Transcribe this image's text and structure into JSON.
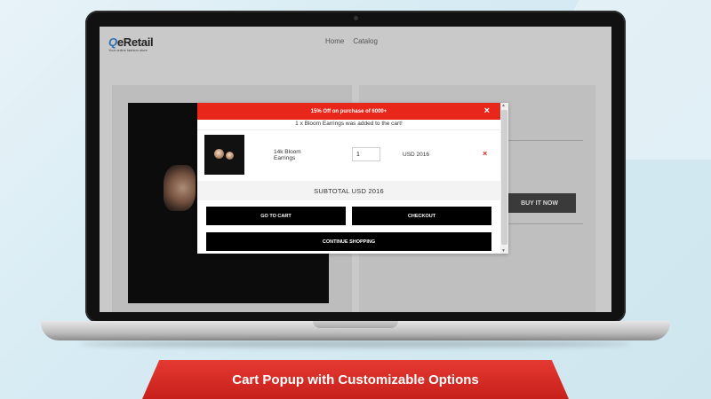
{
  "site": {
    "logo_prefix": "Q",
    "logo_name": "eRetail",
    "logo_tagline": "Your online fashion store",
    "nav": [
      "Home",
      "Catalog"
    ]
  },
  "product_page": {
    "buy_now_label": "BUY IT NOW"
  },
  "popup": {
    "banner": "15% Off on purchase of 6000+",
    "close_label": "×",
    "added_message": "1 x Bloom Earrings was added to the cart!",
    "item": {
      "name_line1": "14k Bloom",
      "name_line2": "Earrings",
      "quantity": "1",
      "price": "USD 2016",
      "remove_label": "×"
    },
    "subtotal": "SUBTOTAL USD 2016",
    "buttons": {
      "go_to_cart": "GO TO CART",
      "checkout": "CHECKOUT",
      "continue_shopping": "CONTINUE SHOPPING"
    }
  },
  "ribbon_title": "Cart Popup with Customizable Options",
  "colors": {
    "accent_red": "#e8261a",
    "button_black": "#000000"
  }
}
